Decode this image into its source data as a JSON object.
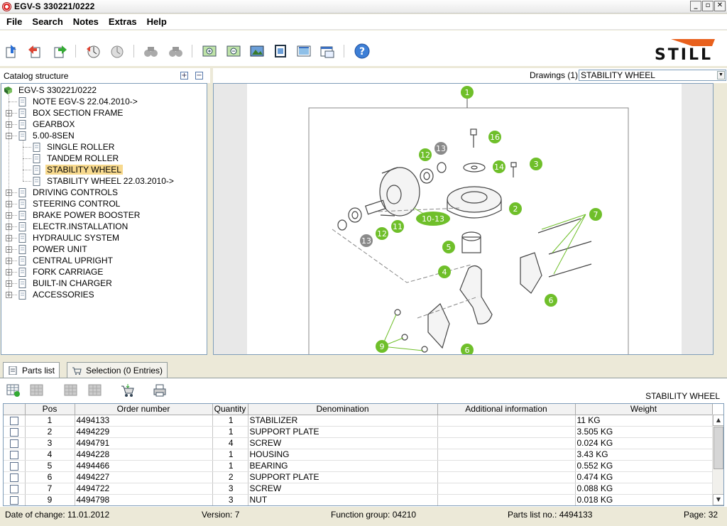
{
  "window": {
    "title": "EGV-S  330221/0222",
    "minimize": "_",
    "restore": "▫",
    "close": "✕"
  },
  "menu": [
    "File",
    "Search",
    "Notes",
    "Extras",
    "Help"
  ],
  "brand": "STILL",
  "toolbar_icons": [
    "home-icon",
    "back-icon",
    "forward-icon",
    "history-back-icon",
    "history-forward-icon",
    "previous-binoculars-icon",
    "next-binoculars-icon",
    "zoom-in-icon",
    "zoom-out-icon",
    "fit-image-icon",
    "full-page-icon",
    "picture-icon",
    "window-icon",
    "print-preview-icon",
    "help-icon"
  ],
  "catalog": {
    "title": "Catalog structure",
    "expand_all": "+",
    "collapse_all": "−",
    "root": "EGV-S  330221/0222",
    "items": [
      {
        "label": "NOTE EGV-S  22.04.2010->",
        "level": 1,
        "exp": ""
      },
      {
        "label": "BOX SECTION FRAME",
        "level": 1,
        "exp": "+"
      },
      {
        "label": "GEARBOX",
        "level": 1,
        "exp": "+"
      },
      {
        "label": "5.00-8SEN",
        "level": 1,
        "exp": "−"
      },
      {
        "label": "SINGLE ROLLER",
        "level": 2,
        "exp": ""
      },
      {
        "label": "TANDEM ROLLER",
        "level": 2,
        "exp": ""
      },
      {
        "label": "STABILITY WHEEL",
        "level": 2,
        "exp": "",
        "selected": true
      },
      {
        "label": "STABILITY WHEEL  22.03.2010->",
        "level": 2,
        "exp": ""
      },
      {
        "label": "DRIVING CONTROLS",
        "level": 1,
        "exp": "+"
      },
      {
        "label": "STEERING CONTROL",
        "level": 1,
        "exp": "+"
      },
      {
        "label": "BRAKE POWER BOOSTER",
        "level": 1,
        "exp": "+"
      },
      {
        "label": "ELECTR.INSTALLATION",
        "level": 1,
        "exp": "+"
      },
      {
        "label": "HYDRAULIC SYSTEM",
        "level": 1,
        "exp": "+"
      },
      {
        "label": "POWER UNIT",
        "level": 1,
        "exp": "+"
      },
      {
        "label": "CENTRAL UPRIGHT",
        "level": 1,
        "exp": "+"
      },
      {
        "label": "FORK CARRIAGE",
        "level": 1,
        "exp": "+"
      },
      {
        "label": "BUILT-IN CHARGER",
        "level": 1,
        "exp": "+"
      },
      {
        "label": "ACCESSORIES",
        "level": 1,
        "exp": "+"
      }
    ]
  },
  "drawings": {
    "label": "Drawings (1)",
    "selected": "STABILITY WHEEL",
    "arrow": "▼"
  },
  "callouts": [
    "1",
    "16",
    "12",
    "13",
    "14",
    "3",
    "2",
    "10-13",
    "11",
    "12",
    "13",
    "5",
    "4",
    "7",
    "6",
    "9",
    "6"
  ],
  "tabs": [
    {
      "label": "Parts list"
    },
    {
      "label": "Selection (0 Entries)"
    }
  ],
  "parts": {
    "title": "STABILITY WHEEL",
    "columns": [
      "",
      "Pos",
      "Order number",
      "Quantity",
      "Denomination",
      "Additional information",
      "Weight"
    ],
    "rows": [
      {
        "pos": "1",
        "order": "4494133",
        "qty": "1",
        "denom": "STABILIZER",
        "info": "",
        "weight": "11 KG"
      },
      {
        "pos": "2",
        "order": "4494229",
        "qty": "1",
        "denom": "SUPPORT PLATE",
        "info": "",
        "weight": "3.505 KG"
      },
      {
        "pos": "3",
        "order": "4494791",
        "qty": "4",
        "denom": "SCREW",
        "info": "",
        "weight": "0.024 KG"
      },
      {
        "pos": "4",
        "order": "4494228",
        "qty": "1",
        "denom": "HOUSING",
        "info": "",
        "weight": "3.43 KG"
      },
      {
        "pos": "5",
        "order": "4494466",
        "qty": "1",
        "denom": "BEARING",
        "info": "",
        "weight": "0.552 KG"
      },
      {
        "pos": "6",
        "order": "4494227",
        "qty": "2",
        "denom": "SUPPORT PLATE",
        "info": "",
        "weight": "0.474 KG"
      },
      {
        "pos": "7",
        "order": "4494722",
        "qty": "3",
        "denom": "SCREW",
        "info": "",
        "weight": "0.088 KG"
      },
      {
        "pos": "9",
        "order": "4494798",
        "qty": "3",
        "denom": "NUT",
        "info": "",
        "weight": "0.018 KG"
      }
    ]
  },
  "status": {
    "date": "Date of change: 11.01.2012",
    "version": "Version: 7",
    "function_group": "Function group: 04210",
    "parts_list_no": "Parts list no.: 4494133",
    "page": "Page: 32"
  },
  "colors": {
    "callout": "#6fbf2a",
    "callout_gray": "#8a8a8a",
    "selection": "#f7d98e",
    "logo_orange": "#e8601c"
  }
}
